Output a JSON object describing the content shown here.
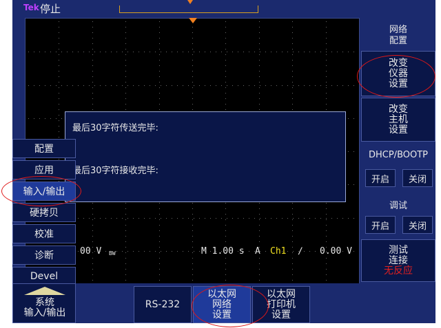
{
  "header": {
    "logo": "Tek",
    "status": "停止"
  },
  "dialog": {
    "tx_line": "最后30字符传送完毕:",
    "rx_line": "最后30字符接收完毕:"
  },
  "readout": {
    "ch_scale": "00 V",
    "bw_mark": "BW",
    "timebase": "M 1.00 s",
    "trigger_mode": "A",
    "trigger_source": "Ch1",
    "trigger_slope": "∕",
    "trigger_level": "0.00 V"
  },
  "right_menu": {
    "network_config": [
      "网络",
      "配置"
    ],
    "change_instrument": [
      "改变",
      "仪器",
      "设置"
    ],
    "change_host": [
      "改变",
      "主机",
      "设置"
    ],
    "dhcp_title": "DHCP/BOOTP",
    "dhcp_on": "开启",
    "dhcp_off": "关闭",
    "debug_title": "调试",
    "debug_on": "开启",
    "debug_off": "关闭",
    "test_connection": [
      "测试",
      "连接"
    ],
    "test_status": "无反应"
  },
  "left_menu": {
    "items": [
      "配置",
      "应用",
      "输入/输出",
      "硬拷贝",
      "校准",
      "诊断",
      "Devel"
    ],
    "system_io": [
      "系统",
      "输入/输出"
    ]
  },
  "bottom_menu": {
    "rs232": "RS-232",
    "ethernet_network": [
      "以太网",
      "网络",
      "设置"
    ],
    "ethernet_printer": [
      "以太网",
      "打印机",
      "设置"
    ]
  },
  "colors": {
    "screen_bg": "#1b2a6e",
    "button_bg": "#0a1648",
    "selected_bg": "#1f3a9a",
    "annotation_red": "#e01818",
    "trigger_orange": "#f08020",
    "ch1_yellow": "#f0e020"
  }
}
